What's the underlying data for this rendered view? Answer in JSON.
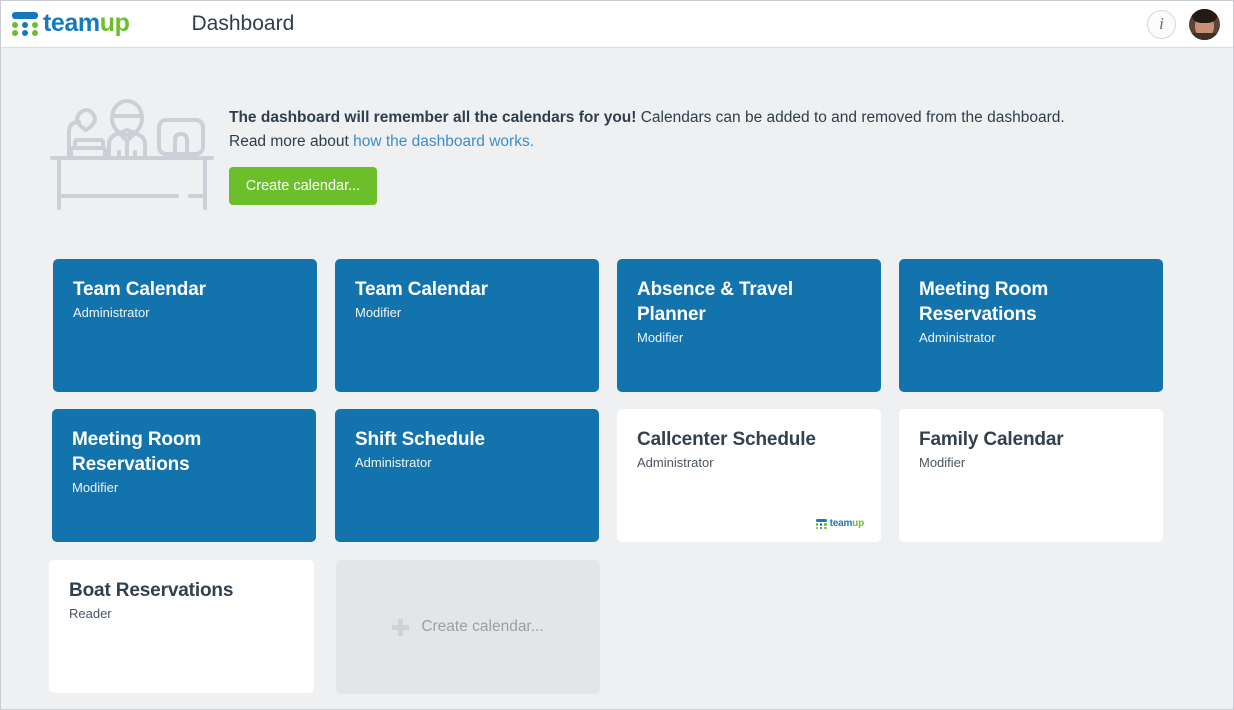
{
  "header": {
    "logo_team": "team",
    "logo_up": "up",
    "title": "Dashboard",
    "info_icon_label": "i",
    "accent_blue": "#1678bd",
    "accent_green": "#6cbe2b"
  },
  "banner": {
    "headline_strong": "The dashboard will remember all the calendars for you!",
    "headline_rest": " Calendars can be added to and removed from the dashboard.",
    "second_line_prefix": "Read more about ",
    "second_line_link": "how the dashboard works.",
    "create_button": "Create calendar..."
  },
  "cards": {
    "badge_team": "team",
    "badge_up": "up",
    "placeholder_label": "Create calendar...",
    "rows": [
      [
        {
          "title": "Team Calendar",
          "role": "Administrator",
          "style": "blue"
        },
        {
          "title": "Team Calendar",
          "role": "Modifier",
          "style": "blue"
        },
        {
          "title": "Absence & Travel Planner",
          "role": "Modifier",
          "style": "blue"
        },
        {
          "title": "Meeting Room Reservations",
          "role": "Administrator",
          "style": "blue"
        }
      ],
      [
        {
          "title": "Meeting Room Reservations",
          "role": "Modifier",
          "style": "blue"
        },
        {
          "title": "Shift Schedule",
          "role": "Administrator",
          "style": "blue"
        },
        {
          "title": "Callcenter Schedule",
          "role": "Administrator",
          "style": "white",
          "badge": true
        },
        {
          "title": "Family Calendar",
          "role": "Modifier",
          "style": "white"
        }
      ],
      [
        {
          "title": "Boat Reservations",
          "role": "Reader",
          "style": "white"
        },
        {
          "placeholder": true
        }
      ]
    ]
  }
}
